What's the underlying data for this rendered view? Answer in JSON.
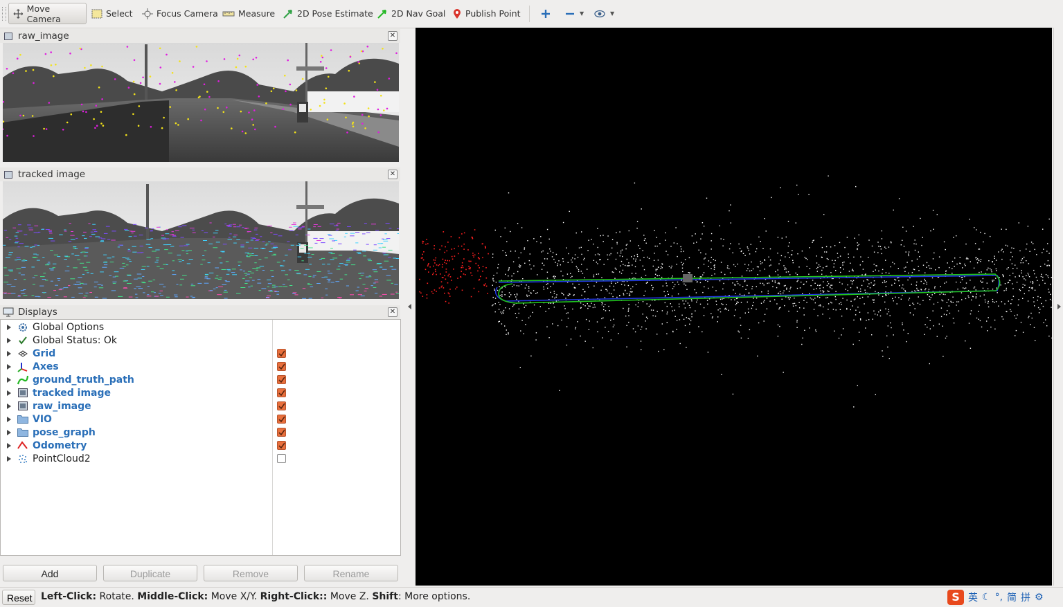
{
  "toolbar": {
    "tools": [
      {
        "label": "Move Camera",
        "icon": "move-camera-icon"
      },
      {
        "label": "Select",
        "icon": "select-icon"
      },
      {
        "label": "Focus Camera",
        "icon": "focus-camera-icon"
      },
      {
        "label": "Measure",
        "icon": "measure-icon"
      },
      {
        "label": "2D Pose Estimate",
        "icon": "pose-arrow-icon"
      },
      {
        "label": "2D Nav Goal",
        "icon": "nav-arrow-icon"
      },
      {
        "label": "Publish Point",
        "icon": "pin-icon"
      }
    ]
  },
  "panels": {
    "raw_image": {
      "title": "raw_image"
    },
    "tracked_image": {
      "title": "tracked image"
    },
    "displays": {
      "title": "Displays"
    }
  },
  "displays": {
    "items": [
      {
        "label": "Global Options",
        "icon": "gear-icon",
        "checked": null
      },
      {
        "label": "Global Status: Ok",
        "icon": "check-icon",
        "checked": null
      },
      {
        "label": "Grid",
        "icon": "grid-icon",
        "checked": true
      },
      {
        "label": "Axes",
        "icon": "axes-icon",
        "checked": true
      },
      {
        "label": "ground_truth_path",
        "icon": "path-icon",
        "checked": true
      },
      {
        "label": "tracked image",
        "icon": "image-icon",
        "checked": true
      },
      {
        "label": "raw_image",
        "icon": "image-icon",
        "checked": true
      },
      {
        "label": "VIO",
        "icon": "folder-icon",
        "checked": true
      },
      {
        "label": "pose_graph",
        "icon": "folder-icon",
        "checked": true
      },
      {
        "label": "Odometry",
        "icon": "odometry-icon",
        "checked": true
      },
      {
        "label": "PointCloud2",
        "icon": "pointcloud-icon",
        "checked": false
      }
    ],
    "buttons": {
      "add": "Add",
      "duplicate": "Duplicate",
      "remove": "Remove",
      "rename": "Rename"
    }
  },
  "statusbar": {
    "reset": "Reset",
    "hint_parts": [
      {
        "k": "Left-Click:",
        "v": " Rotate. "
      },
      {
        "k": "Middle-Click:",
        "v": " Move X/Y. "
      },
      {
        "k": "Right-Click::",
        "v": " Move Z. "
      },
      {
        "k": "Shift",
        "v": ": More options."
      }
    ],
    "tray": [
      "英",
      "简",
      "拼"
    ]
  },
  "colors": {
    "accent": "#2a6fb8",
    "checkbox": "#e86f3c",
    "path_green": "#22c31e",
    "path_blue": "#2238e0"
  }
}
